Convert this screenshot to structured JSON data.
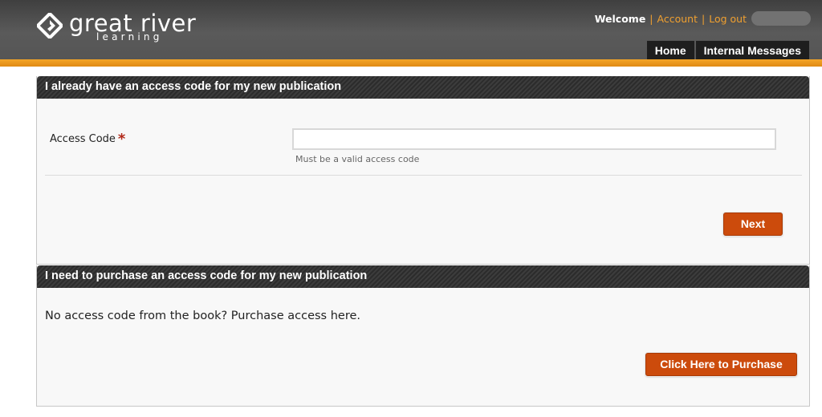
{
  "brand": {
    "name": "great river",
    "tagline": "learning",
    "icon": "great-river-logo-mark"
  },
  "topnav": {
    "welcome": "Welcome",
    "account": "Account",
    "logout": "Log out"
  },
  "tabs": [
    {
      "label": "Home"
    },
    {
      "label": "Internal Messages"
    }
  ],
  "access_section": {
    "title": "I already have an access code for my new publication",
    "field_label": "Access Code",
    "required_marker": "*",
    "input_value": "",
    "hint": "Must be a valid access code",
    "next_button": "Next"
  },
  "purchase_section": {
    "title": "I need to purchase an access code for my new publication",
    "text": "No access code from the book? Purchase access here.",
    "purchase_button": "Click Here to Purchase"
  },
  "colors": {
    "accent_orange": "#f0a030",
    "button_orange": "#cc4b0c",
    "header_dark": "#3f3f3f"
  }
}
